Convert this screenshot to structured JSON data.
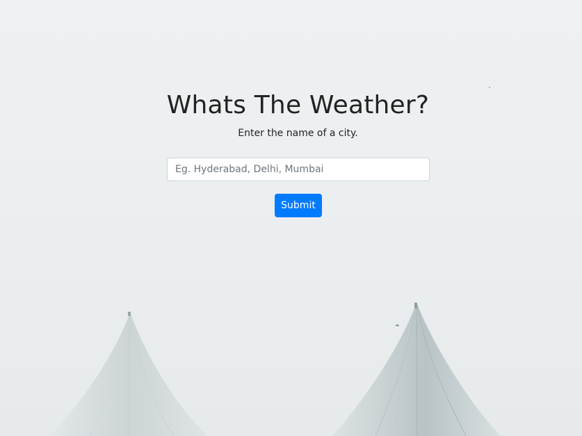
{
  "page": {
    "title": "Whats The Weather?",
    "subtitle": "Enter the name of a city."
  },
  "search": {
    "placeholder": "Eg. Hyderabad, Delhi, Mumbai",
    "value": ""
  },
  "form": {
    "submit_label": "Submit"
  },
  "colors": {
    "accent": "#007bff",
    "background": "#ecf0f1",
    "text": "#222222"
  },
  "background_image": {
    "subject": "two white tent peaks in fog"
  }
}
